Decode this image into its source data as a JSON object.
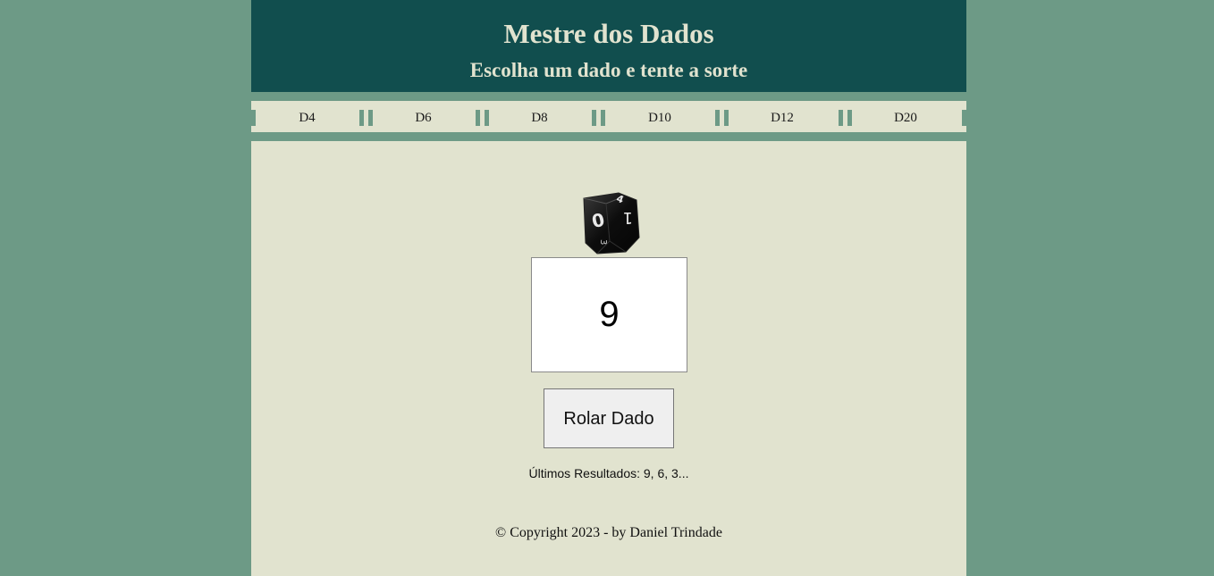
{
  "header": {
    "title": "Mestre dos Dados",
    "subtitle": "Escolha um dado e tente a sorte"
  },
  "nav": {
    "items": [
      {
        "label": "D4"
      },
      {
        "label": "D6"
      },
      {
        "label": "D8"
      },
      {
        "label": "D10"
      },
      {
        "label": "D12"
      },
      {
        "label": "D20"
      }
    ]
  },
  "dice": {
    "image": "d10-dice-icon",
    "faces": [
      "0",
      "4",
      "1",
      "3"
    ]
  },
  "result": {
    "value": "9"
  },
  "roll_button": {
    "label": "Rolar Dado"
  },
  "history": {
    "text": "Últimos Resultados: 9, 6, 3..."
  },
  "footer": {
    "text": "© Copyright 2023 - by Daniel Trindade"
  },
  "colors": {
    "background": "#6d9a86",
    "header_bg": "#114e4e",
    "header_text": "#e1e3cf",
    "panel_bg": "#e1e3cf"
  }
}
